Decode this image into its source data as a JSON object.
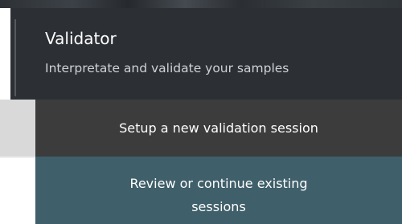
{
  "header": {
    "title": "Validator",
    "subtitle": "Interpretate and validate your samples"
  },
  "menu": {
    "setup_label": "Setup a new validation session",
    "review_label_line1": "Review or continue existing",
    "review_label_line2": "sessions"
  },
  "colors": {
    "header_background": "#2c3035",
    "setup_button_background": "#3c3c3c",
    "review_button_background": "#3f5f6a",
    "text_primary": "#ffffff"
  }
}
